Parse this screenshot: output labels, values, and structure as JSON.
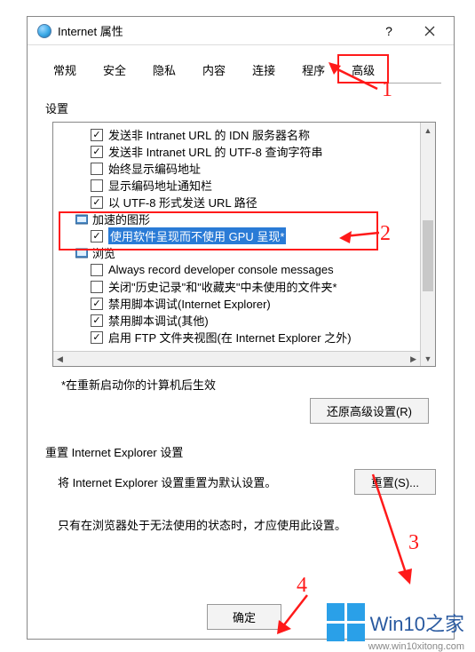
{
  "titlebar": {
    "title": "Internet 属性"
  },
  "tabs": [
    "常规",
    "安全",
    "隐私",
    "内容",
    "连接",
    "程序",
    "高级"
  ],
  "active_tab": 6,
  "settings_label": "设置",
  "tree": [
    {
      "kind": "item",
      "indent": 2,
      "checked": true,
      "label": "发送非 Intranet URL 的 IDN 服务器名称"
    },
    {
      "kind": "item",
      "indent": 2,
      "checked": true,
      "label": "发送非 Intranet URL 的 UTF-8 查询字符串"
    },
    {
      "kind": "item",
      "indent": 2,
      "checked": false,
      "label": "始终显示编码地址"
    },
    {
      "kind": "item",
      "indent": 2,
      "checked": false,
      "label": "显示编码地址通知栏"
    },
    {
      "kind": "item",
      "indent": 2,
      "checked": true,
      "label": "以 UTF-8 形式发送 URL 路径"
    },
    {
      "kind": "cat",
      "indent": 1,
      "icon": "monitor-icon",
      "label": "加速的图形"
    },
    {
      "kind": "item",
      "indent": 2,
      "checked": true,
      "label": "使用软件呈现而不使用 GPU 呈现*",
      "selected": true
    },
    {
      "kind": "cat",
      "indent": 1,
      "icon": "monitor-icon",
      "label": "浏览"
    },
    {
      "kind": "item",
      "indent": 2,
      "checked": false,
      "label": "Always record developer console messages"
    },
    {
      "kind": "item",
      "indent": 2,
      "checked": false,
      "label": "关闭\"历史记录\"和\"收藏夹\"中未使用的文件夹*"
    },
    {
      "kind": "item",
      "indent": 2,
      "checked": true,
      "label": "禁用脚本调试(Internet Explorer)"
    },
    {
      "kind": "item",
      "indent": 2,
      "checked": true,
      "label": "禁用脚本调试(其他)"
    },
    {
      "kind": "item",
      "indent": 2,
      "checked": true,
      "label": "启用 FTP 文件夹视图(在 Internet Explorer 之外)"
    }
  ],
  "restart_note": "*在重新启动你的计算机后生效",
  "restore_btn": "还原高级设置(R)",
  "reset_label": "重置 Internet Explorer 设置",
  "reset_desc": "将 Internet Explorer 设置重置为默认设置。",
  "reset_btn": "重置(S)...",
  "reset_note": "只有在浏览器处于无法使用的状态时，才应使用此设置。",
  "ok_btn": "确定",
  "annotations": {
    "n1": "1",
    "n2": "2",
    "n3": "3",
    "n4": "4"
  },
  "brand": {
    "name": "Win10之家",
    "url": "www.win10xitong.com"
  }
}
